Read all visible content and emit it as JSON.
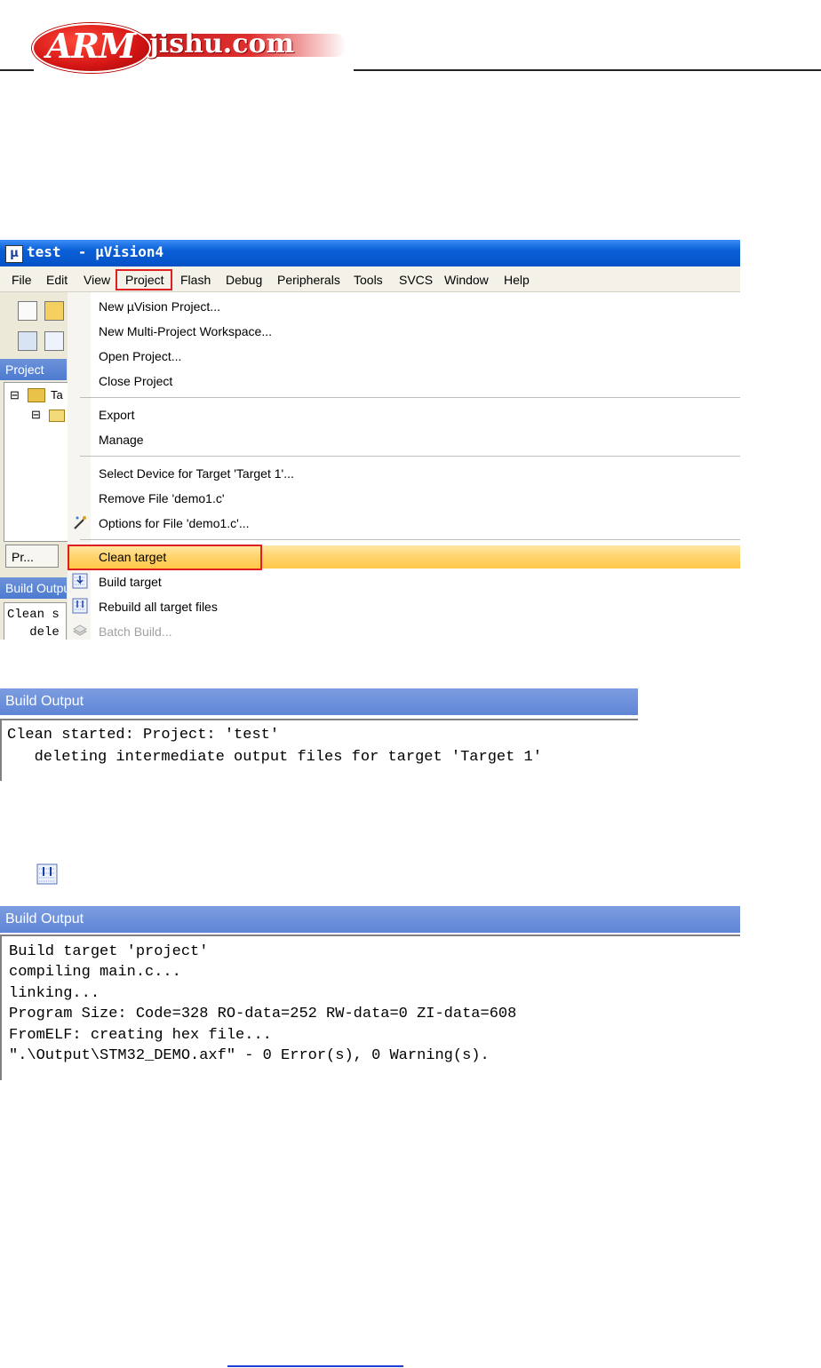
{
  "header": {
    "logo_main": "ARM",
    "logo_domain": "jishu.com"
  },
  "uv4": {
    "window_title": "test  - µVision4",
    "menus": [
      "File",
      "Edit",
      "View",
      "Project",
      "Flash",
      "Debug",
      "Peripherals",
      "Tools",
      "SVCS",
      "Window",
      "Help"
    ],
    "project_panel_title": "Project",
    "tree_root": "Ta",
    "project_tab": "Pr...",
    "build_output_title_short": "Build Outpu",
    "build_output_lines_short": [
      "Clean s",
      "   dele"
    ],
    "project_menu": {
      "new_project": "New µVision Project...",
      "new_workspace": "New Multi-Project Workspace...",
      "open_project": "Open Project...",
      "close_project": "Close Project",
      "export": "Export",
      "manage": "Manage",
      "select_device": "Select Device for Target 'Target 1'...",
      "remove_file": "Remove File 'demo1.c'",
      "options_file": "Options for File 'demo1.c'...",
      "clean_target": "Clean target",
      "build_target": "Build target",
      "rebuild_all": "Rebuild all target files",
      "batch_build": "Batch Build..."
    }
  },
  "clean_output": {
    "title": "Build Output",
    "lines": [
      "Clean started: Project: 'test'",
      "   deleting intermediate output files for target 'Target 1'"
    ]
  },
  "build_output": {
    "title": "Build Output",
    "lines": [
      "Build target 'project'",
      "compiling main.c...",
      "linking...",
      "Program Size: Code=328 RO-data=252 RW-data=0 ZI-data=608",
      "FromELF: creating hex file...",
      "\".\\Output\\STM32_DEMO.axf\" - 0 Error(s), 0 Warning(s)."
    ]
  },
  "colors": {
    "titlebar": "#0552c7",
    "highlight": "#ffd36b",
    "annotation_red": "#e02020",
    "panel_header": "#5f85d6"
  }
}
